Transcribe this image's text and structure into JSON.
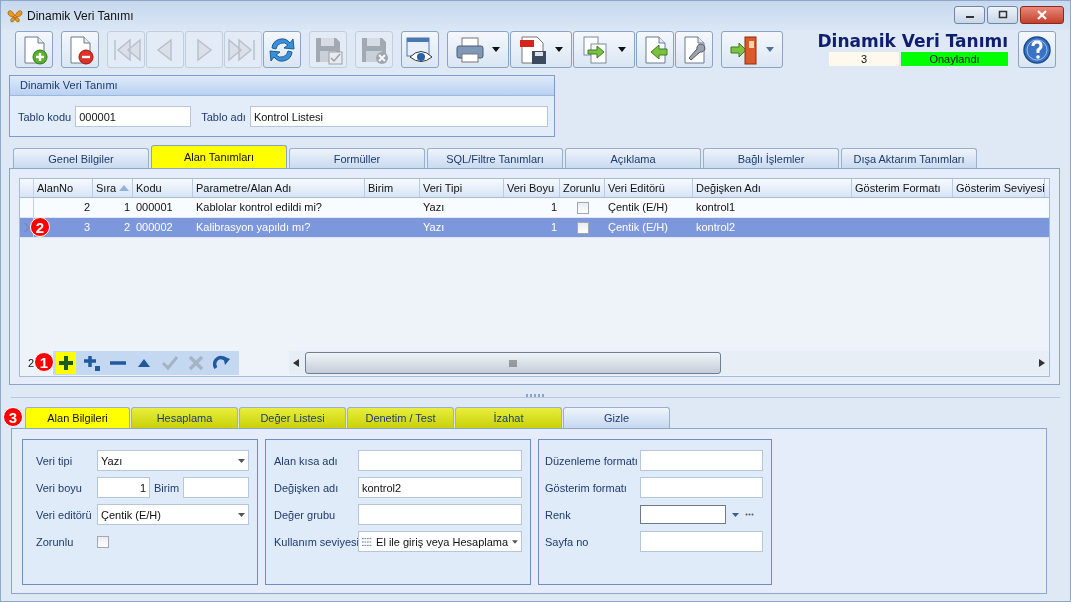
{
  "window": {
    "title": "Dinamik Veri Tanımı"
  },
  "toolbar": {
    "groups": [
      [
        {
          "kind": "new",
          "disabled": false,
          "dropdown": false
        }
      ],
      [
        {
          "kind": "delete",
          "disabled": false,
          "dropdown": false
        }
      ],
      [
        {
          "kind": "first",
          "disabled": true,
          "dropdown": false
        },
        {
          "kind": "prev",
          "disabled": true,
          "dropdown": false
        },
        {
          "kind": "next",
          "disabled": true,
          "dropdown": false
        },
        {
          "kind": "last",
          "disabled": true,
          "dropdown": false
        },
        {
          "kind": "refresh",
          "disabled": false,
          "dropdown": false
        }
      ],
      [
        {
          "kind": "save",
          "disabled": true,
          "dropdown": false
        }
      ],
      [
        {
          "kind": "discard",
          "disabled": true,
          "dropdown": false
        }
      ],
      [
        {
          "kind": "preview",
          "disabled": false,
          "dropdown": false
        }
      ],
      [
        {
          "kind": "print",
          "disabled": false,
          "dropdown": true
        },
        {
          "kind": "pdf",
          "disabled": false,
          "dropdown": true
        },
        {
          "kind": "export",
          "disabled": false,
          "dropdown": true
        },
        {
          "kind": "import",
          "disabled": false,
          "dropdown": false
        },
        {
          "kind": "tools",
          "disabled": false,
          "dropdown": false
        }
      ],
      [
        {
          "kind": "exit",
          "disabled": false,
          "dropdown": true
        }
      ]
    ]
  },
  "header": {
    "title": "Dinamik Veri Tanımı",
    "status_number": "3",
    "status_label": "Onaylandı"
  },
  "definition": {
    "title": "Dinamik Veri Tanımı",
    "fields": [
      {
        "label": "Tablo kodu",
        "value": "000001"
      },
      {
        "label": "Tablo adı",
        "value": "Kontrol Listesi"
      }
    ]
  },
  "tabs": [
    {
      "label": "Genel Bilgiler",
      "selected": false
    },
    {
      "label": "Alan Tanımları",
      "selected": true
    },
    {
      "label": "Formüller",
      "selected": false
    },
    {
      "label": "SQL/Filtre Tanımları",
      "selected": false
    },
    {
      "label": "Açıklama",
      "selected": false
    },
    {
      "label": "Bağlı İşlemler",
      "selected": false
    },
    {
      "label": "Dışa Aktarım Tanımları",
      "selected": false
    }
  ],
  "table": {
    "columns": [
      {
        "label": "AlanNo",
        "kind": "number",
        "sorted": false
      },
      {
        "label": "Sıra",
        "kind": "number",
        "sorted": true
      },
      {
        "label": "Kodu",
        "kind": "text",
        "sorted": false
      },
      {
        "label": "Parametre/Alan Adı",
        "kind": "text",
        "sorted": false
      },
      {
        "label": "Birim",
        "kind": "text",
        "sorted": false
      },
      {
        "label": "Veri Tipi",
        "kind": "text",
        "sorted": false
      },
      {
        "label": "Veri Boyu",
        "kind": "number",
        "sorted": false
      },
      {
        "label": "Zorunlu",
        "kind": "check",
        "sorted": false
      },
      {
        "label": "Veri Editörü",
        "kind": "text",
        "sorted": false
      },
      {
        "label": "Değişken Adı",
        "kind": "text",
        "sorted": false
      },
      {
        "label": "Gösterim Formatı",
        "kind": "text",
        "sorted": false
      },
      {
        "label": "Gösterim Seviyesi",
        "kind": "text",
        "sorted": false
      }
    ],
    "rows": [
      {
        "selected": false,
        "cells": [
          "2",
          "1",
          "000001",
          "Kablolar kontrol edildi mi?",
          null,
          "Yazı",
          "1",
          false,
          "Çentik (E/H)",
          "kontrol1",
          null,
          null
        ]
      },
      {
        "selected": true,
        "callout": "2",
        "cells": [
          "3",
          "2",
          "000002",
          "Kalibrasyon yapıldı mı?",
          null,
          "Yazı",
          "1",
          false,
          "Çentik (E/H)",
          "kontrol2",
          null,
          null
        ]
      }
    ],
    "navigator": {
      "record_count": "2",
      "callout": "1",
      "buttons": [
        {
          "kind": "add",
          "disabled": false,
          "highlighted": true
        },
        {
          "kind": "add-child",
          "disabled": false,
          "highlighted": false
        },
        {
          "kind": "remove",
          "disabled": false,
          "highlighted": false
        },
        {
          "kind": "up",
          "disabled": false,
          "highlighted": false
        },
        {
          "kind": "confirm",
          "disabled": true,
          "highlighted": false
        },
        {
          "kind": "cancel",
          "disabled": true,
          "highlighted": false
        },
        {
          "kind": "redo",
          "disabled": false,
          "highlighted": false
        }
      ]
    }
  },
  "detail_tabs": {
    "callout": "3",
    "tabs": [
      {
        "label": "Alan Bilgileri",
        "selected": true,
        "highlighted": true
      },
      {
        "label": "Hesaplama",
        "selected": false,
        "highlighted": true
      },
      {
        "label": "Değer Listesi",
        "selected": false,
        "highlighted": true
      },
      {
        "label": "Denetim / Test",
        "selected": false,
        "highlighted": true
      },
      {
        "label": "İzahat",
        "selected": false,
        "highlighted": true
      },
      {
        "label": "Gizle",
        "selected": false,
        "highlighted": false
      }
    ]
  },
  "detail_groups": [
    {
      "fields": [
        {
          "kind": "combo",
          "label": "Veri tipi",
          "value": "Yazı"
        },
        {
          "kind": "number_unit",
          "label": "Veri boyu",
          "value": "1",
          "unit_label": "Birim"
        },
        {
          "kind": "combo",
          "label": "Veri editörü",
          "value": "Çentik (E/H)"
        },
        {
          "kind": "checkbox",
          "label": "Zorunlu",
          "checked": false
        }
      ]
    },
    {
      "fields": [
        {
          "kind": "text",
          "label": "Alan kısa adı"
        },
        {
          "kind": "text",
          "label": "Değişken adı",
          "value": "kontrol2"
        },
        {
          "kind": "text",
          "label": "Değer grubu"
        },
        {
          "kind": "icon_combo",
          "label": "Kullanım seviyesi",
          "value": "El ile giriş veya Hesaplama"
        }
      ]
    },
    {
      "fields": [
        {
          "kind": "text",
          "label": "Düzenleme formatı"
        },
        {
          "kind": "text",
          "label": "Gösterim formatı"
        },
        {
          "kind": "color",
          "label": "Renk"
        },
        {
          "kind": "text",
          "label": "Sayfa no"
        }
      ]
    }
  ]
}
